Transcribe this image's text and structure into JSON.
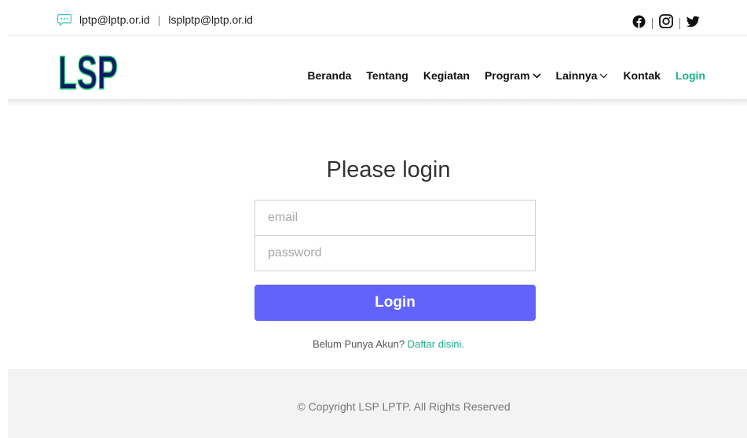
{
  "topbar": {
    "email_primary": "lptp@lptp.or.id",
    "separator": "|",
    "email_secondary": "lsplptp@lptp.or.id",
    "icons": [
      "chat-icon",
      "facebook-icon",
      "instagram-icon",
      "twitter-icon"
    ]
  },
  "logo": {
    "text": "LSP"
  },
  "nav": {
    "items": [
      {
        "label": "Beranda"
      },
      {
        "label": "Tentang"
      },
      {
        "label": "Kegiatan"
      },
      {
        "label": "Program"
      },
      {
        "label": "Lainnya"
      },
      {
        "label": "Kontak"
      },
      {
        "label": "Login"
      }
    ]
  },
  "login": {
    "title": "Please login",
    "email_placeholder": "email",
    "password_placeholder": "password",
    "button_label": "Login",
    "signup_prompt": "Belum Punya Akun?",
    "signup_link": "Daftar disini."
  },
  "footer": {
    "copyright": "© Copyright LSP LPTP. All Rights Reserved"
  },
  "colors": {
    "accent": "#1cb18e",
    "button": "#6163fb",
    "logo_fill": "#0d1a66",
    "logo_outline": "#1fd16a",
    "footer_bg": "#f3f3f3"
  }
}
